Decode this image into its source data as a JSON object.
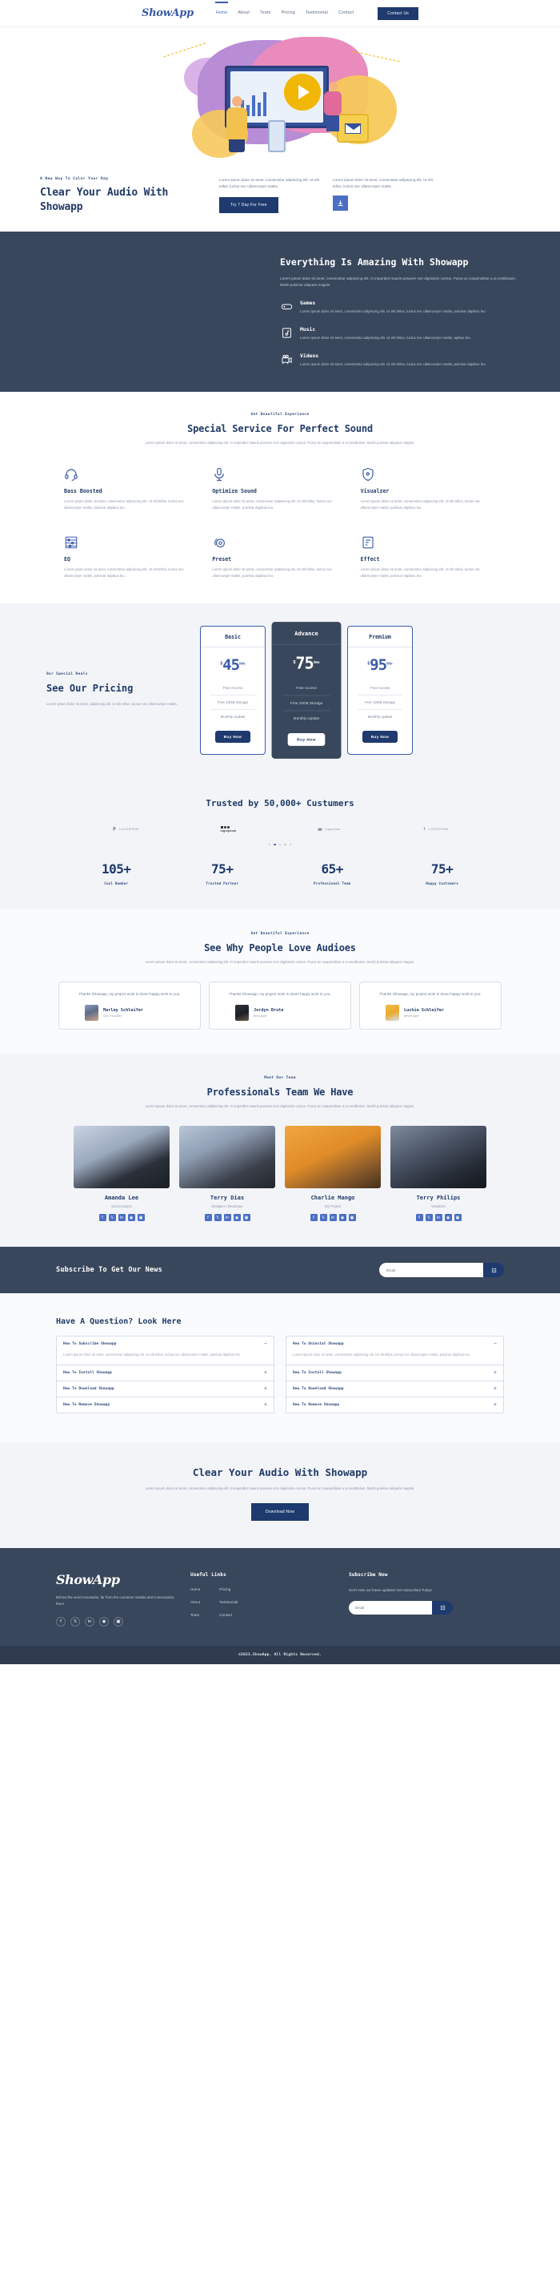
{
  "nav": {
    "logo": "ShowApp",
    "links": [
      {
        "label": "Home",
        "active": true
      },
      {
        "label": "About",
        "active": false
      },
      {
        "label": "Team",
        "active": false
      },
      {
        "label": "Pricing",
        "active": false
      },
      {
        "label": "Testimonial",
        "active": false
      },
      {
        "label": "Contact",
        "active": false
      }
    ],
    "cta_label": "Contact Us"
  },
  "hero": {
    "eyebrow": "A New Way To Color Your Day",
    "title": "Clear Your Audio With Showapp",
    "col1_text": "Lorem ipsum dolor sit amet, consectetur adipiscing elit. Ut elit tellus, luctus nec ullamcorper mattis.",
    "col2_text": "Lorem ipsum dolor sit amet, consectetur adipiscing elit. Ut elit tellus, luctus nec ullamcorper mattis.",
    "primary_btn": "Try 7 Day For Free",
    "download_icon": "download-icon"
  },
  "amazing": {
    "title": "Everything Is Amazing With Showapp",
    "description": "Lorem ipsum dolor sit amet, consectetur adipiscing elit. In imperdiet mauris posuere non dignissim cursus. Purus ac suspendisse a ut vestibulum. Morbi pulvinar aliquam magnis.",
    "features": [
      {
        "icon": "gamepad-icon",
        "title": "Games",
        "desc": "Lorem ipsum dolor sit amet, consectetur adipiscing elit. Ut elit tellus, luctus nec ullamcorper mattis, pulvinar dapibus leo."
      },
      {
        "icon": "music-note-icon",
        "title": "Music",
        "desc": "Lorem ipsum dolor sit amet, consectetur adipiscing elit. Ut elit tellus, luctus nec ullamcorper mattis, apibus leo."
      },
      {
        "icon": "video-camera-icon",
        "title": "Videos",
        "desc": "Lorem ipsum dolor sit amet, consectetur adipiscing elit. Ut elit tellus, luctus nec ullamcorper mattis, pulvinar dapibus leo."
      }
    ]
  },
  "services": {
    "eyebrow": "Get Beautiful Experience",
    "title": "Special Service For Perfect Sound",
    "subtitle": "Lorem ipsum dolor sit amet, consectetur adipiscing elit. In imperdiet mauris posuere non dignissim cursus. Purus ac suspendisse a ut vestibulum. Morbi pulvinar aliquam magnis.",
    "items": [
      {
        "icon": "headphone-icon",
        "title": "Bass Boosted",
        "desc": "Lorem ipsum dolor sit amet, consectetur adipiscing elit. Ut elit tellus, luctus nec ullamcorper mattis, pulvinar dapibus leo."
      },
      {
        "icon": "microphone-icon",
        "title": "Optimize Sound",
        "desc": "Lorem ipsum dolor sit amet, consectetur adipiscing elit. Ut elit tellus, luctus nec ullamcorper mattis, pulvinar dapibus leo."
      },
      {
        "icon": "shield-icon",
        "title": "Visualzer",
        "desc": "Lorem ipsum dolor sit amet, consectetur adipiscing elit. Ut elit tellus, luctus nec ullamcorper mattis, pulvinar dapibus leo."
      },
      {
        "icon": "equalizer-icon",
        "title": "EQ",
        "desc": "Lorem ipsum dolor sit amet, consectetur adipiscing elit. Ut elit tellus, luctus nec ullamcorper mattis, pulvinar dapibus leo."
      },
      {
        "icon": "preset-gear-icon",
        "title": "Preset",
        "desc": "Lorem ipsum dolor sit amet, consectetur adipiscing elit. Ut elit tellus, luctus nec ullamcorper mattis, pulvinar dapibus leo."
      },
      {
        "icon": "effect-panel-icon",
        "title": "Effect",
        "desc": "Lorem ipsum dolor sit amet, consectetur adipiscing elit. Ut elit tellus, luctus nec ullamcorper mattis, pulvinar dapibus leo."
      }
    ]
  },
  "pricing": {
    "eyebrow": "Our Special Deals",
    "title": "See Our Pricing",
    "description": "Lorem ipsum dolor sit amet, adipiscing elit. Ut elit tellus, luctus nec ullamcorper mattis.",
    "plans": [
      {
        "name": "Basic",
        "currency": "$",
        "amount": "45",
        "period": "/Mo",
        "features": [
          "Free Access",
          "Free 10GB Storage",
          "Monthly Update"
        ],
        "cta": "Buy Now",
        "featured": false
      },
      {
        "name": "Advance",
        "currency": "$",
        "amount": "75",
        "period": "/Mo",
        "features": [
          "Free Access",
          "Free 10GB Storage",
          "Monthly Update"
        ],
        "cta": "Buy Now",
        "featured": true
      },
      {
        "name": "Premium",
        "currency": "$",
        "amount": "95",
        "period": "/Mo",
        "features": [
          "Free Access",
          "Free 10GB Storage",
          "Monthly Update"
        ],
        "cta": "Buy Now",
        "featured": false
      }
    ]
  },
  "trusted": {
    "title": "Trusted by 50,000+ Custumers",
    "brands": [
      "LOGOIPSUM",
      "logoipsum",
      "logoipsum",
      "LOGOIPSUM"
    ],
    "carousel_dots": 5,
    "active_dot": 1,
    "stats": [
      {
        "value": "105+",
        "label": "Cool Number"
      },
      {
        "value": "75+",
        "label": "Trusted Partner"
      },
      {
        "value": "65+",
        "label": "Professional Team"
      },
      {
        "value": "75+",
        "label": "Happy Customers"
      }
    ]
  },
  "testimonials": {
    "eyebrow": "Get Beautiful Experience",
    "title": "See Why People Love Audioes",
    "subtitle": "Lorem ipsum dolor sit amet, consectetur adipiscing elit. In imperdiet mauris posuere non dignissim cursus. Purus ac suspendisse a ut vestibulum. Morbi pulvinar aliquam magnis.",
    "cards": [
      {
        "quote": "Thanks Showapp, my project work is done! happy work to you.",
        "name": "Marley Schleifer",
        "role": "CEO-Founder"
      },
      {
        "quote": "Thanks Showapp, my project work is done! happy work to you.",
        "name": "Jordyn Brute",
        "role": "Designer"
      },
      {
        "quote": "Thanks Showapp, my project work is done! happy work to you.",
        "name": "Luchie Schleifer",
        "role": "Developer"
      }
    ]
  },
  "team": {
    "eyebrow": "Meet Our Team",
    "title": "Professionals Team We Have",
    "subtitle": "Lorem ipsum dolor sit amet, consectetur adipiscing elit. In imperdiet mauris posuere non dignissim cursus. Purus ac suspendisse a ut vestibulum. Morbi pulvinar aliquam magnis.",
    "members": [
      {
        "name": "Amanda Lee",
        "role": "Senior project"
      },
      {
        "name": "Terry Dias",
        "role": "Designer / Developer"
      },
      {
        "name": "Charlie Mango",
        "role": "EQ Project"
      },
      {
        "name": "Terry Philips",
        "role": "Visualizer"
      }
    ],
    "social_icons": [
      "facebook-icon",
      "twitter-icon",
      "linkedin-icon",
      "dribbble-icon",
      "instagram-icon"
    ]
  },
  "subscribe_bar": {
    "title": "Subscribe To Get Our News",
    "placeholder": "Email",
    "button_icon": "send-icon"
  },
  "faq": {
    "title": "Have A Question? Look Here",
    "answer_text": "Lorem ipsum dolor sit amet, consectetur adipiscing elit. Ut elit tellus, luctus nec ullamcorper mattis, pulvinar dapibus leo.",
    "left_column": [
      {
        "q": "How To Subscribe Showapp",
        "open": true,
        "sign": "−"
      },
      {
        "q": "How To Install Showapp",
        "open": false,
        "sign": "+"
      },
      {
        "q": "How To Download Showapp",
        "open": false,
        "sign": "+"
      },
      {
        "q": "How To Remove Showapp",
        "open": false,
        "sign": "+"
      }
    ],
    "right_column": [
      {
        "q": "How To Uninstal Showapp",
        "open": true,
        "sign": "−"
      },
      {
        "q": "How To Install Showapp",
        "open": false,
        "sign": "+"
      },
      {
        "q": "How To Download Showapp",
        "open": false,
        "sign": "+"
      },
      {
        "q": "How To Remove Showapp",
        "open": false,
        "sign": "+"
      }
    ]
  },
  "cta": {
    "title": "Clear Your Audio With Showapp",
    "text": "Lorem ipsum dolor sit amet, consectetur adipiscing elit. In imperdiet mauris posuere non dignissim cursus. Purus ac suspendisse a ut vestibulum. Morbi pulvinar aliquam magnis.",
    "button": "Download Now"
  },
  "footer": {
    "logo": "ShowApp",
    "about": "Behind the word mountains, far from the countries Vokalia and Consonantia, there",
    "socials": [
      "facebook-icon",
      "twitter-icon",
      "linkedin-icon",
      "dribbble-icon",
      "instagram-icon"
    ],
    "links_title": "Useful Links",
    "links_col1": [
      "Home",
      "About",
      "Team"
    ],
    "links_col2": [
      "Pricing",
      "Testimonial",
      "Contact"
    ],
    "subscribe_title": "Subscribe Now",
    "subscribe_text": "Don't miss our future updates! Get Subscribed Today!",
    "placeholder": "Email",
    "button_icon": "send-icon",
    "copyright": "©2023.ShowApp. All Rights Reserved."
  },
  "colors": {
    "brand_blue": "#3b5ba9",
    "deep_navy": "#1e3a6e",
    "dark_slate": "#39475c",
    "light_bg": "#f2f4f8",
    "accent_yellow": "#f2b705"
  }
}
